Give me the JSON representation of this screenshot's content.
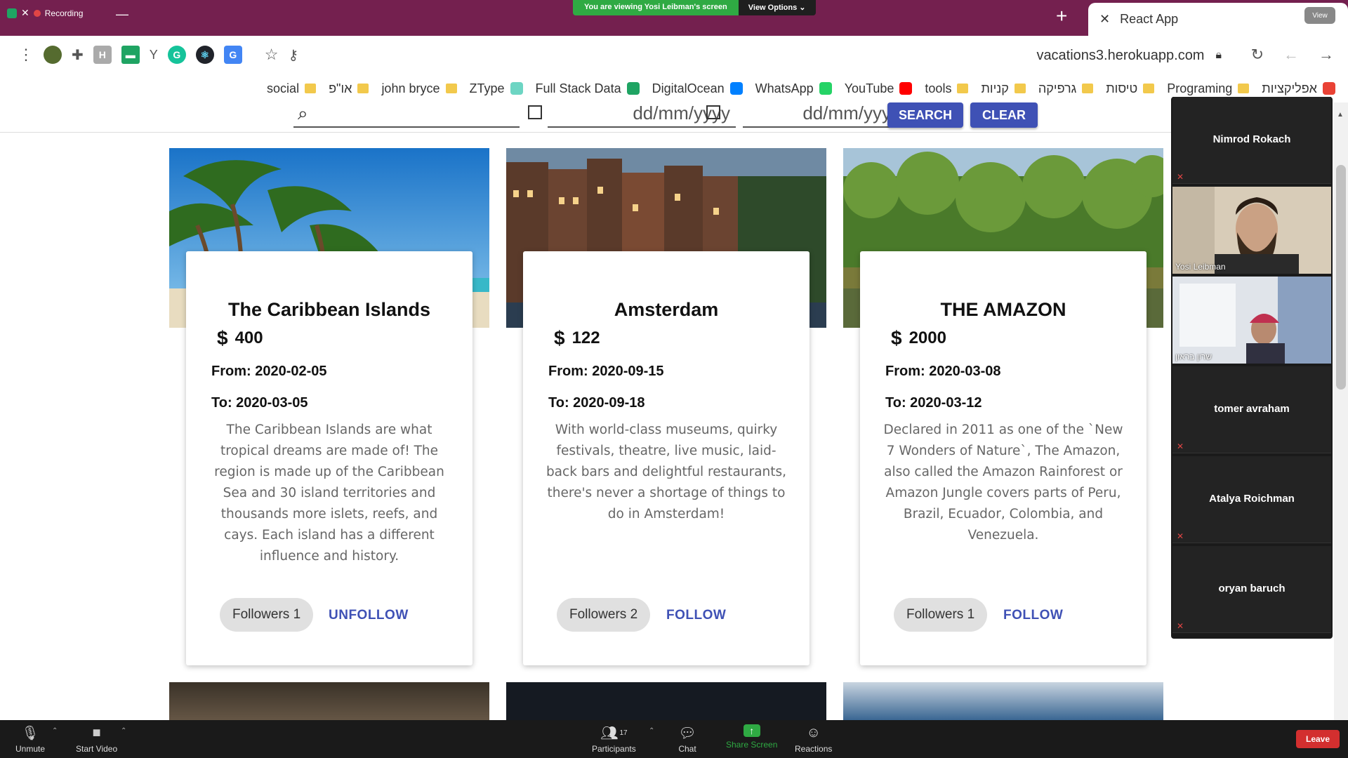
{
  "zoom_top": {
    "recording_label": "Recording",
    "share_message": "You are viewing Yosi Leibman's screen",
    "view_options": "View Options",
    "view_badge": "View"
  },
  "browser": {
    "tab_title": "React App",
    "url": "vacations3.herokuapp.com",
    "bookmarks": [
      {
        "label": "אפליקציות",
        "icon": "apps-grid-icon"
      },
      {
        "label": "Programing",
        "icon": "folder-icon"
      },
      {
        "label": "טיסות",
        "icon": "folder-icon"
      },
      {
        "label": "גרפיקה",
        "icon": "folder-icon"
      },
      {
        "label": "קניות",
        "icon": "folder-icon"
      },
      {
        "label": "tools",
        "icon": "folder-icon"
      },
      {
        "label": "YouTube",
        "icon": "youtube-icon"
      },
      {
        "label": "WhatsApp",
        "icon": "whatsapp-icon"
      },
      {
        "label": "DigitalOcean",
        "icon": "digitalocean-icon"
      },
      {
        "label": "Full Stack Data",
        "icon": "drive-icon"
      },
      {
        "label": "ZType",
        "icon": "ztype-icon"
      },
      {
        "label": "john bryce",
        "icon": "folder-icon"
      },
      {
        "label": "או\"פ",
        "icon": "folder-icon"
      },
      {
        "label": "social",
        "icon": "folder-icon"
      }
    ]
  },
  "search": {
    "date_from_placeholder": "dd/mm/yyyy",
    "date_to_placeholder": "dd/mm/yyyy",
    "search_label": "SEARCH",
    "clear_label": "CLEAR"
  },
  "cards": [
    {
      "title": "The Caribbean Islands",
      "currency": "$",
      "price": "400",
      "from": "From: 2020-02-05",
      "to": "To: 2020-03-05",
      "description": "The Caribbean Islands are what tropical dreams are made of! The region is made up of the Caribbean Sea and 30 island territories and thousands more islets, reefs, and cays. Each island has a different influence and history.",
      "followers": "Followers 1",
      "action": "UNFOLLOW"
    },
    {
      "title": "Amsterdam",
      "currency": "$",
      "price": "122",
      "from": "From: 2020-09-15",
      "to": "To: 2020-09-18",
      "description": "With world-class museums, quirky festivals, theatre, live music, laid-back bars and delightful restaurants, there's never a shortage of things to do in Amsterdam!",
      "followers": "Followers 2",
      "action": "FOLLOW"
    },
    {
      "title": "THE AMAZON",
      "currency": "$",
      "price": "2000",
      "from": "From: 2020-03-08",
      "to": "To: 2020-03-12",
      "description": "Declared in 2011 as one of the `New 7 Wonders of Nature`, The Amazon, also called the Amazon Rainforest or Amazon Jungle covers parts of Peru, Brazil, Ecuador, Colombia, and Venezuela.",
      "followers": "Followers 1",
      "action": "FOLLOW"
    }
  ],
  "participants": [
    {
      "name": "Nimrod Rokach",
      "video": false
    },
    {
      "name": "Yosi Leibman",
      "video": true
    },
    {
      "name": "שרון בראון",
      "video": true
    },
    {
      "name": "tomer avraham",
      "video": false
    },
    {
      "name": "Atalya Roichman",
      "video": false
    },
    {
      "name": "oryan baruch",
      "video": false
    }
  ],
  "zoombar": {
    "unmute": "Unmute",
    "start_video": "Start Video",
    "participants": "Participants",
    "participants_count": "17",
    "chat": "Chat",
    "share_screen": "Share Screen",
    "reactions": "Reactions",
    "leave": "Leave"
  }
}
